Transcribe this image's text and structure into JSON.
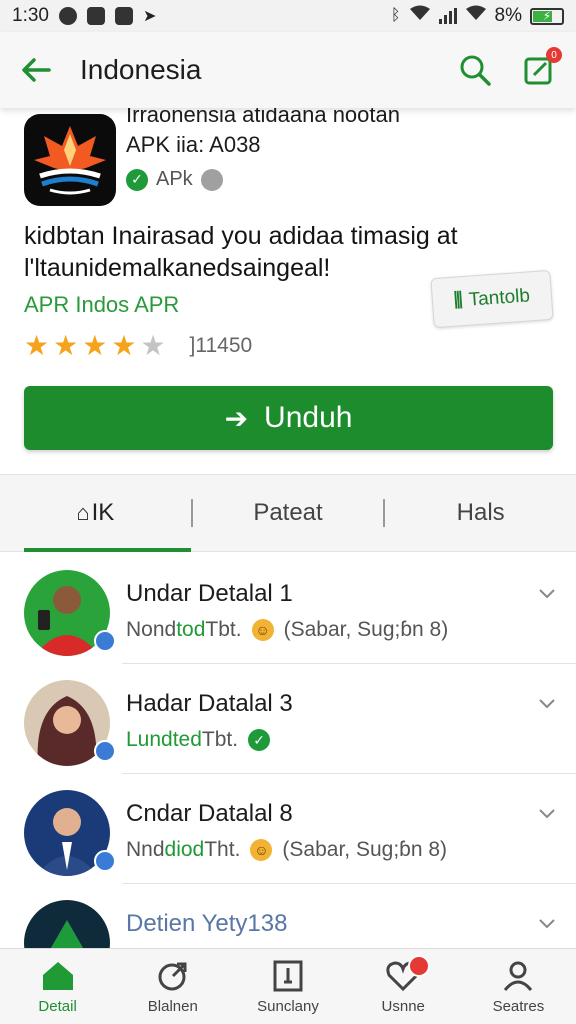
{
  "status_bar": {
    "time": "1:30",
    "battery": "8%"
  },
  "app_bar": {
    "title": "Indonesia",
    "notification_count": "0"
  },
  "app": {
    "name_line1": "Irraonensia atidaana nootan",
    "name_line2": "APK iia: A038",
    "verified_label": "APk",
    "headline": "kidbtan Inairasad you adidaa timasig at l'ltaunidemalkanedsaingeal!",
    "developer": "APR Indos APR",
    "rating": 4,
    "rating_max": 5,
    "rating_count": "]11450",
    "tag_label": "Tantolb",
    "download_label": "Unduh"
  },
  "tabs": [
    {
      "label": "IK",
      "active": true
    },
    {
      "label": "Pateat",
      "active": false
    },
    {
      "label": "Hals",
      "active": false
    }
  ],
  "list": [
    {
      "title": "Undar Detalal 1",
      "sub_prefix": "Nond",
      "sub_highlight": "tod",
      "sub_suffix": "Tbt.",
      "sub_icon": "emoji",
      "sub_extra": "(Sabar, Sug;ɓn 8)"
    },
    {
      "title": "Hadar Datalal 3",
      "sub_prefix": "",
      "sub_highlight": "Lundted",
      "sub_suffix": "Tbt.",
      "sub_icon": "check",
      "sub_extra": ""
    },
    {
      "title": "Cndar Datalal 8",
      "sub_prefix": "Nnd",
      "sub_highlight": "diod",
      "sub_suffix": "Tht.",
      "sub_icon": "emoji",
      "sub_extra": "(Sabar, Sug;ɓn 8)"
    },
    {
      "title": "Detien Yety138",
      "sub_prefix": "",
      "sub_highlight": "",
      "sub_suffix": "",
      "sub_icon": "",
      "sub_extra": ""
    }
  ],
  "bottom_nav": [
    {
      "label": "Detail",
      "icon": "home-icon",
      "active": true
    },
    {
      "label": "Blalnen",
      "icon": "share-icon",
      "active": false
    },
    {
      "label": "Sunclany",
      "icon": "document-icon",
      "active": false
    },
    {
      "label": "Usnne",
      "icon": "heart-icon",
      "active": false
    },
    {
      "label": "Seatres",
      "icon": "person-icon",
      "active": false
    }
  ],
  "colors": {
    "accent": "#1c8c2c",
    "star": "#f6a21b",
    "badge": "#e53935"
  }
}
